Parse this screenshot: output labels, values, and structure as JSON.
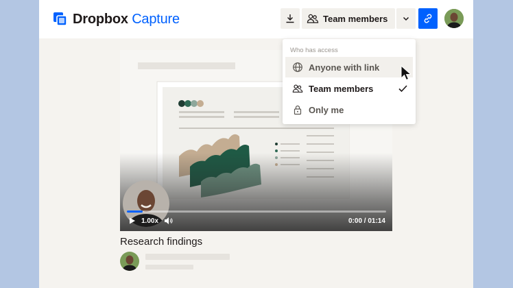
{
  "app": {
    "logo_brand": "Dropbox",
    "logo_product": "Capture"
  },
  "toolbar": {
    "access_label": "Team members"
  },
  "access_menu": {
    "header": "Who has access",
    "items": [
      {
        "label": "Anyone with link",
        "icon": "globe-icon",
        "selected": false,
        "hovered": true
      },
      {
        "label": "Team members",
        "icon": "people-icon",
        "selected": true,
        "hovered": false
      },
      {
        "label": "Only me",
        "icon": "lock-icon",
        "selected": false,
        "hovered": false
      }
    ]
  },
  "video": {
    "speed": "1.00x",
    "time": "0:00 / 01:14",
    "progress": 0.02
  },
  "capture": {
    "title": "Research findings"
  },
  "colors": {
    "brand_blue": "#0061fe",
    "dark_green": "#1f5a45",
    "sage_green": "#6f9483",
    "tan": "#c4ad92",
    "background_blue": "#b3c6e3"
  }
}
